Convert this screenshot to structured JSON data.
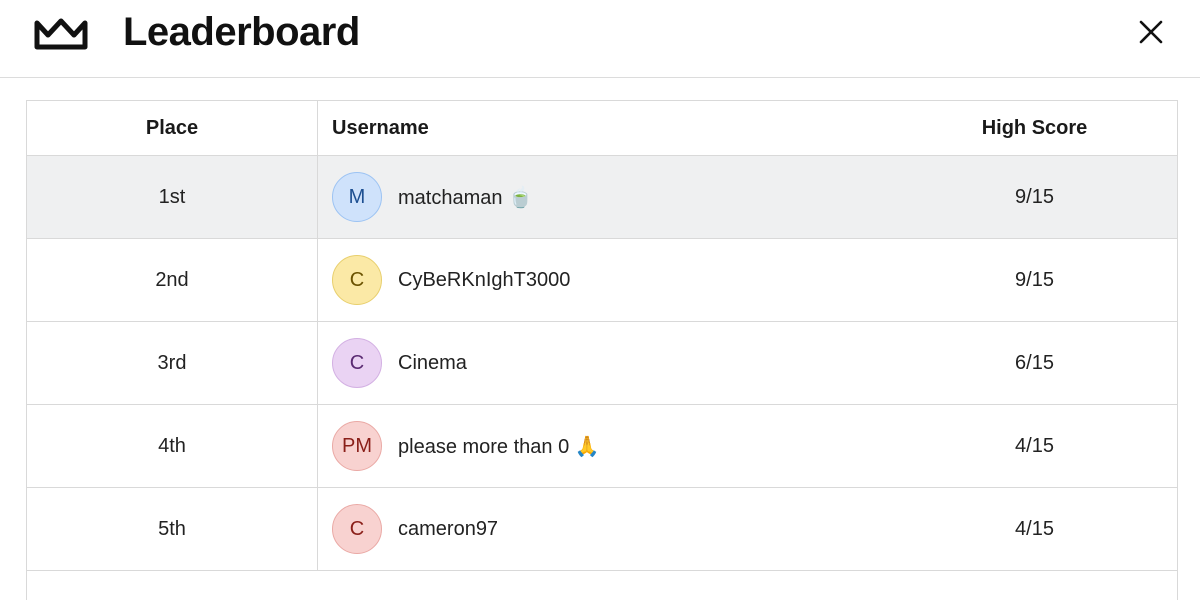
{
  "header": {
    "title": "Leaderboard",
    "crown_icon": "crown-icon",
    "close_icon": "close-icon"
  },
  "table": {
    "columns": [
      "Place",
      "Username",
      "High Score"
    ],
    "rows": [
      {
        "place": "1st",
        "initials": "M",
        "username": "matchaman 🍵",
        "score": "9/15",
        "avatar_bg": "#cfe2fb",
        "avatar_border": "#9cc3f3",
        "avatar_fg": "#1d4f91"
      },
      {
        "place": "2nd",
        "initials": "C",
        "username": "CyBeRKnIghT3000",
        "score": "9/15",
        "avatar_bg": "#fbe9a6",
        "avatar_border": "#e8cf6d",
        "avatar_fg": "#6b5200"
      },
      {
        "place": "3rd",
        "initials": "C",
        "username": "Cinema",
        "score": "6/15",
        "avatar_bg": "#ead3f3",
        "avatar_border": "#d3b0e3",
        "avatar_fg": "#5a2a72"
      },
      {
        "place": "4th",
        "initials": "PM",
        "username": "please more than 0 🙏",
        "score": "4/15",
        "avatar_bg": "#f8d2d0",
        "avatar_border": "#eaa9a5",
        "avatar_fg": "#8a1f19"
      },
      {
        "place": "5th",
        "initials": "C",
        "username": "cameron97",
        "score": "4/15",
        "avatar_bg": "#f8d2d0",
        "avatar_border": "#eaa9a5",
        "avatar_fg": "#8a1f19"
      }
    ],
    "highlight_color": "#eff0f1"
  }
}
